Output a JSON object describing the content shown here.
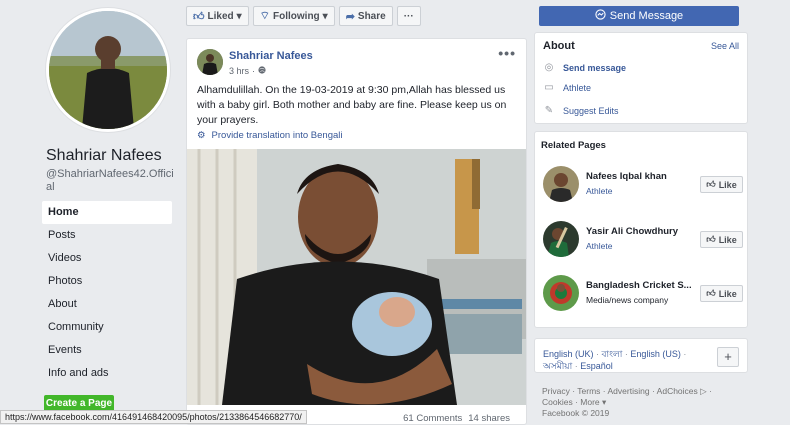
{
  "profile": {
    "name": "Shahriar Nafees",
    "handle": "@ShahriarNafees42.Official"
  },
  "nav": {
    "items": [
      {
        "label": "Home",
        "active": true
      },
      {
        "label": "Posts"
      },
      {
        "label": "Videos"
      },
      {
        "label": "Photos"
      },
      {
        "label": "About"
      },
      {
        "label": "Community"
      },
      {
        "label": "Events"
      },
      {
        "label": "Info and ads"
      }
    ],
    "create_page": "Create a Page"
  },
  "actions": {
    "liked": "Liked",
    "following": "Following",
    "share": "Share",
    "more": "···",
    "send_message": "Send Message"
  },
  "post": {
    "author": "Shahriar Nafees",
    "time": "3 hrs",
    "menu": "•••",
    "text": "Alhamdulillah. On the 19-03-2019 at 9:30 pm,Allah has blessed us with a baby girl. Both mother and baby are fine. Please keep us on your prayers.",
    "translate": "Provide translation into Bengali",
    "comments": "61 Comments",
    "shares": "14 shares"
  },
  "about": {
    "title": "About",
    "see_all": "See All",
    "send_message": "Send message",
    "category": "Athlete",
    "suggest_edits": "Suggest Edits"
  },
  "related": {
    "title": "Related Pages",
    "like_label": "Like",
    "items": [
      {
        "name": "Nafees Iqbal khan",
        "category": "Athlete"
      },
      {
        "name": "Yasir Ali Chowdhury",
        "category": "Athlete"
      },
      {
        "name": "Bangladesh Cricket S...",
        "category": "Media/news company"
      }
    ]
  },
  "languages": {
    "items": [
      "English (UK)",
      "বাংলা",
      "English (US)",
      "অসমীয়া",
      "Español"
    ],
    "add": "+"
  },
  "footer": {
    "links": [
      "Privacy",
      "Terms",
      "Advertising",
      "AdChoices",
      "Cookies",
      "More"
    ],
    "copyright": "Facebook © 2019"
  },
  "status_bar": {
    "url": "https://www.facebook.com/416491468420095/photos/2133864546682770/"
  }
}
